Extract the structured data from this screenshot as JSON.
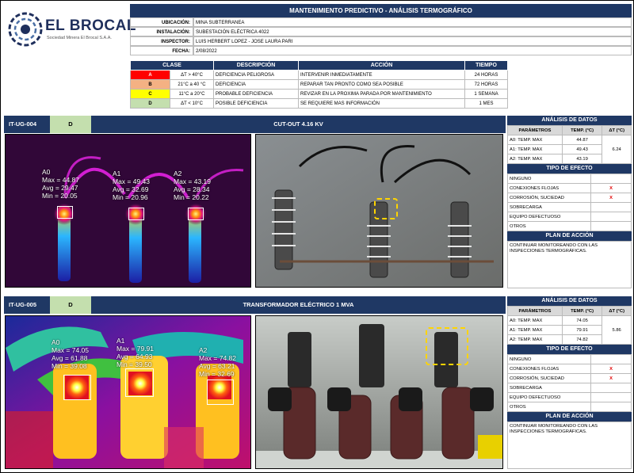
{
  "company": {
    "name": "EL BROCAL",
    "subtitle": "Sociedad Minera El Brocal S.A.A."
  },
  "header": {
    "title": "MANTENIMIENTO PREDICTIVO - ANÁLISIS TERMOGRÁFICO",
    "fields": [
      {
        "label": "UBICACIÓN:",
        "value": "MINA SUBTERRANEA"
      },
      {
        "label": "INSTALACIÓN:",
        "value": "SUBESTACIÓN ELÉCTRICA 4022"
      },
      {
        "label": "INSPECTOR:",
        "value": "LUIS HERBERT LOPEZ - JOSE LAURA PARI"
      },
      {
        "label": "FECHA:",
        "value": "2/08/2022"
      }
    ]
  },
  "legend": {
    "headers": [
      "CLASE",
      "DESCRIPCIÓN",
      "ACCIÓN",
      "TIEMPO"
    ],
    "rows": [
      {
        "class": "A",
        "color": "#ff0000",
        "range": "ΔT > 40°C",
        "desc": "DEFICIENCIA PELIGROSA",
        "action": "INTERVENIR INMEDIATAMENTE",
        "time": "24 HORAS"
      },
      {
        "class": "B",
        "color": "#f4b183",
        "range": "21°C a 40 °C",
        "desc": "DEFICIENCIA",
        "action": "REPARAR TAN PRONTO COMO SEA POSIBLE",
        "time": "72 HORAS"
      },
      {
        "class": "C",
        "color": "#ffff00",
        "range": "11°C a 20°C",
        "desc": "PROBABLE DEFICIENCIA",
        "action": "REVIZAR EN LA PROXIMA PARADA POR MANTENIMIENTO",
        "time": "1 SEMANA"
      },
      {
        "class": "D",
        "color": "#c4dfae",
        "range": "ΔT < 10°C",
        "desc": "POSIBLE DEFICIENCIA",
        "action": "SE REQUIERE MAS INFORMACIÓN",
        "time": "1 MES"
      }
    ]
  },
  "sections": [
    {
      "code": "IT-UG-004",
      "class": "D",
      "title": "CUT-OUT 4.16 KV",
      "thermal": [
        {
          "label": "A0",
          "max": "Max = 44.87",
          "avg": "Avg = 29.47",
          "min": "Min = 20.05"
        },
        {
          "label": "A1",
          "max": "Max = 49.43",
          "avg": "Avg = 32.69",
          "min": "Min = 20.96"
        },
        {
          "label": "A2",
          "max": "Max = 43.19",
          "avg": "Avg = 28.34",
          "min": "Min = 20.22"
        }
      ],
      "analysis": {
        "head": "ANÁLISIS DE DATOS",
        "cols": [
          "PARÁMETROS",
          "TEMP. (°C)",
          "ΔT (°C)"
        ],
        "rows": [
          {
            "param": "A0: TEMP. MAX",
            "temp": "44.87"
          },
          {
            "param": "A1: TEMP. MAX",
            "temp": "49.43"
          },
          {
            "param": "A2: TEMP. MAX",
            "temp": "43.19"
          }
        ],
        "delta": "6.24"
      },
      "effect": {
        "head": "TIPO DE EFECTO",
        "rows": [
          {
            "label": "NINGUNO",
            "mark": ""
          },
          {
            "label": "CONEXIONES FLOJAS",
            "mark": "X"
          },
          {
            "label": "CORROSIÓN, SUCIEDAD",
            "mark": "X"
          },
          {
            "label": "SOBRECARGA",
            "mark": ""
          },
          {
            "label": "EQUIPO DEFECTUOSO",
            "mark": ""
          },
          {
            "label": "OTROS",
            "mark": ""
          }
        ]
      },
      "plan": {
        "head": "PLAN DE ACCIÓN",
        "text": "CONTINUAR MONITOREANDO CON LAS INSPECCIONES TERMOGRÁFICAS."
      }
    },
    {
      "code": "IT-UG-005",
      "class": "D",
      "title": "TRANSFORMADOR ELÉCTRICO 1 MVA",
      "thermal": [
        {
          "label": "A0",
          "max": "Max = 74.05",
          "avg": "Avg = 61.88",
          "min": "Min = 39.08"
        },
        {
          "label": "A1",
          "max": "Max = 79.91",
          "avg": "Avg = 64.93",
          "min": "Min = 39.50"
        },
        {
          "label": "A2",
          "max": "Max = 74.82",
          "avg": "Avg = 63.21",
          "min": "Min = 32.69"
        }
      ],
      "analysis": {
        "head": "ANÁLISIS DE DATOS",
        "cols": [
          "PARÁMETROS",
          "TEMP. (°C)",
          "ΔT (°C)"
        ],
        "rows": [
          {
            "param": "A0: TEMP. MAX",
            "temp": "74.05"
          },
          {
            "param": "A1: TEMP. MAX",
            "temp": "79.91"
          },
          {
            "param": "A2: TEMP. MAX",
            "temp": "74.82"
          }
        ],
        "delta": "5.86"
      },
      "effect": {
        "head": "TIPO DE EFECTO",
        "rows": [
          {
            "label": "NINGUNO",
            "mark": ""
          },
          {
            "label": "CONEXIONES FLOJAS",
            "mark": "X"
          },
          {
            "label": "CORROSIÓN, SUCIEDAD",
            "mark": "X"
          },
          {
            "label": "SOBRECARGA",
            "mark": ""
          },
          {
            "label": "EQUIPO DEFECTUOSO",
            "mark": ""
          },
          {
            "label": "OTROS",
            "mark": ""
          }
        ]
      },
      "plan": {
        "head": "PLAN DE ACCIÓN",
        "text": "CONTINUAR MONITOREANDO CON LAS INSPECCIONES TERMOGRÁFICAS."
      }
    }
  ]
}
